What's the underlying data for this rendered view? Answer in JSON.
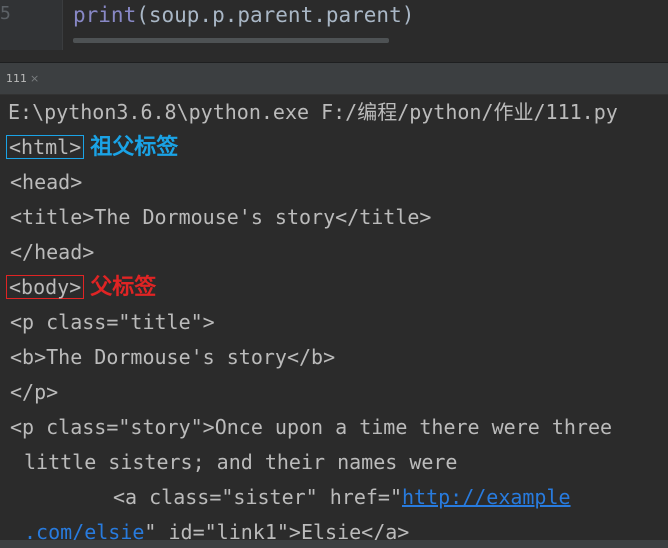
{
  "editor": {
    "line_number": "5",
    "code_fn": "print",
    "code_rest": "(soup.p.parent.parent)"
  },
  "run_tab": {
    "label": "111",
    "close_glyph": "×"
  },
  "console": {
    "command": "E:\\python3.6.8\\python.exe F:/编程/python/作业/111.py",
    "html_tag": "<html>",
    "html_annotation": "祖父标签",
    "head_open": "<head>",
    "title_line": "<title>The Dormouse's story</title>",
    "head_close": "</head>",
    "body_tag": "<body>",
    "body_annotation": "父标签",
    "p_title_open": "<p class=\"title\">",
    "b_line": "<b>The Dormouse's story</b>",
    "p_close": "</p>",
    "p_story_line1": "<p class=\"story\">Once upon a time there were three",
    "p_story_line2": "little sisters; and their names were",
    "a_prefix": "<a class=\"sister\" href=\"",
    "a_link_part1": "http://example",
    "a_link_part2": ".com/elsie",
    "a_suffix": "\" id=\"link1\">Elsie</a>"
  },
  "colors": {
    "annotation_blue": "#1aa3e6",
    "annotation_red": "#e02424",
    "link": "#287bde"
  }
}
